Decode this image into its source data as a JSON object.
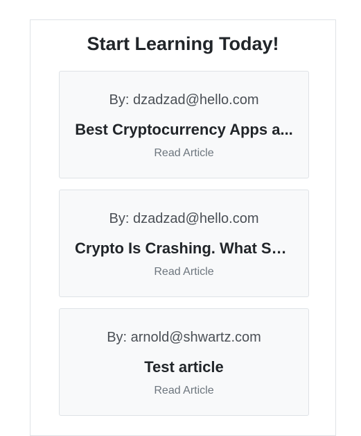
{
  "page": {
    "title": "Start Learning Today!"
  },
  "articles": [
    {
      "author": "By: dzadzad@hello.com",
      "title": "Best Cryptocurrency Apps a...",
      "link_label": "Read Article"
    },
    {
      "author": "By: dzadzad@hello.com",
      "title": "Crypto Is Crashing. What Sh...",
      "link_label": "Read Article"
    },
    {
      "author": "By: arnold@shwartz.com",
      "title": "Test article",
      "link_label": "Read Article"
    }
  ]
}
